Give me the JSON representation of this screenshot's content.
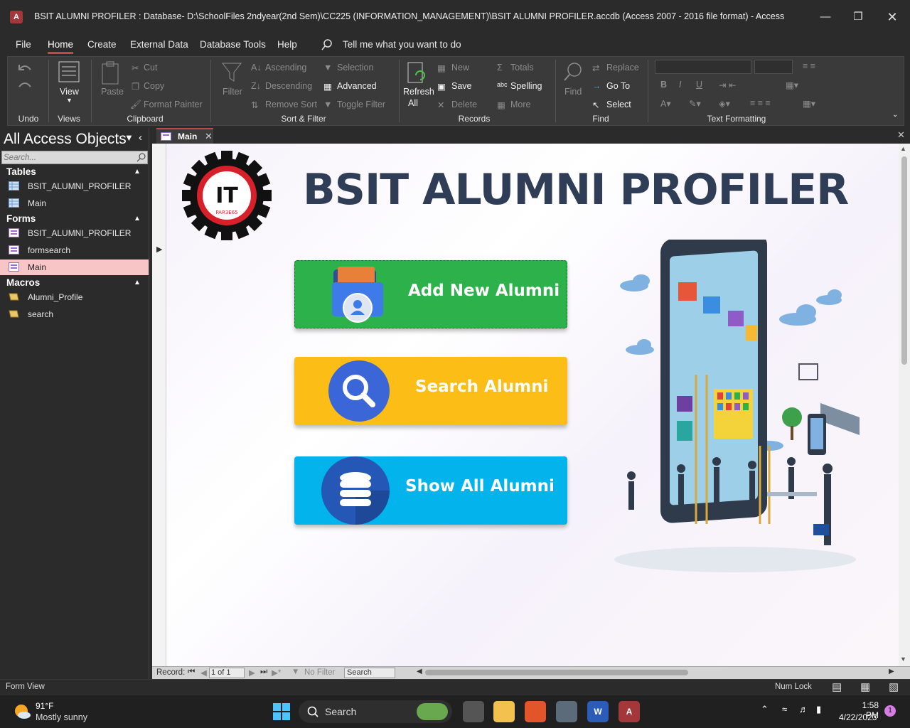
{
  "window": {
    "title": "BSIT ALUMNI PROFILER : Database- D:\\SchoolFiles 2ndyear(2nd Sem)\\CC225 (INFORMATION_MANAGEMENT)\\BSIT ALUMNI PROFILER.accdb (Access 2007 - 2016 file format)  -  Access",
    "app_icon_letter": "A"
  },
  "menu": {
    "tabs": [
      "File",
      "Home",
      "Create",
      "External Data",
      "Database Tools",
      "Help"
    ],
    "active": "Home",
    "tell_me": "Tell me what you want to do"
  },
  "ribbon": {
    "undo_group": "Undo",
    "views_group": "Views",
    "view_label": "View",
    "clipboard_group": "Clipboard",
    "paste": "Paste",
    "cut": "Cut",
    "copy": "Copy",
    "format_painter": "Format Painter",
    "sort_group": "Sort & Filter",
    "filter": "Filter",
    "ascending": "Ascending",
    "descending": "Descending",
    "remove_sort": "Remove Sort",
    "selection": "Selection",
    "advanced": "Advanced",
    "toggle_filter": "Toggle Filter",
    "records_group": "Records",
    "refresh_all_1": "Refresh",
    "refresh_all_2": "All",
    "new": "New",
    "save": "Save",
    "delete": "Delete",
    "totals": "Totals",
    "spelling": "Spelling",
    "more": "More",
    "find_group": "Find",
    "find": "Find",
    "replace": "Replace",
    "goto": "Go To",
    "select": "Select",
    "text_formatting_group": "Text Formatting",
    "bold": "B",
    "italic": "I",
    "underline": "U"
  },
  "nav": {
    "header": "All Access Objects",
    "search_placeholder": "Search...",
    "categories": [
      {
        "name": "Tables",
        "items": [
          "BSIT_ALUMNI_PROFILER",
          "Main"
        ]
      },
      {
        "name": "Forms",
        "items": [
          "BSIT_ALUMNI_PROFILER",
          "formsearch",
          "Main"
        ]
      },
      {
        "name": "Macros",
        "items": [
          "Alumni_Profile",
          "search"
        ]
      }
    ],
    "selected_item": "Main"
  },
  "document": {
    "tab_label": "Main",
    "form_title": "BSIT ALUMNI PROFILER",
    "logo_text": "IT",
    "logo_subtext": "PAR3E65",
    "buttons": {
      "add": "Add New Alumni",
      "search": "Search Alumni",
      "show": "Show All Alumni"
    },
    "colors": {
      "add": "#2db14b",
      "search": "#fbbd16",
      "show": "#03b4ec",
      "title": "#2f3d57"
    }
  },
  "record_nav": {
    "label": "Record:",
    "position": "1 of 1",
    "filter": "No Filter",
    "search": "Search"
  },
  "status": {
    "view": "Form View",
    "num_lock": "Num Lock"
  },
  "taskbar": {
    "temp": "91°F",
    "weather": "Mostly sunny",
    "search": "Search",
    "time": "1:58 PM",
    "date": "4/22/2023",
    "notifications": "1"
  }
}
